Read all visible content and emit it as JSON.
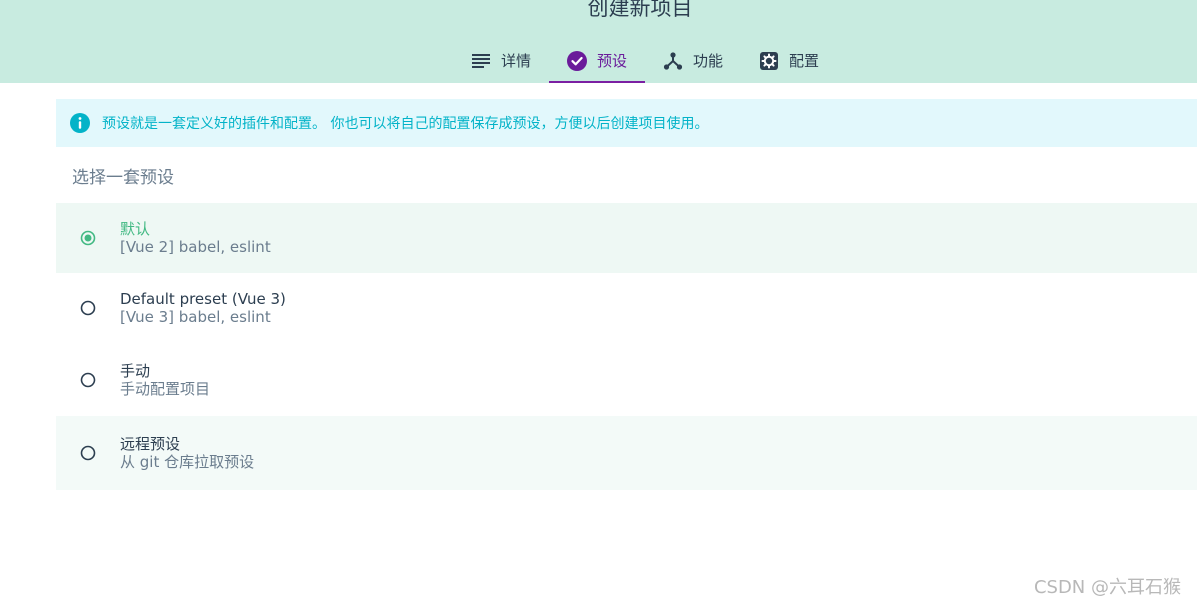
{
  "page": {
    "title": "创建新项目"
  },
  "tabs": [
    {
      "label": "详情",
      "icon": "list-icon",
      "active": false
    },
    {
      "label": "预设",
      "icon": "check-circle-icon",
      "active": true
    },
    {
      "label": "功能",
      "icon": "fork-icon",
      "active": false
    },
    {
      "label": "配置",
      "icon": "gear-icon",
      "active": false
    }
  ],
  "info": {
    "text": "预设就是一套定义好的插件和配置。 你也可以将自己的配置保存成预设，方便以后创建项目使用。"
  },
  "section": {
    "title": "选择一套预设"
  },
  "presets": [
    {
      "name": "默认",
      "desc": "[Vue 2] babel, eslint",
      "selected": true
    },
    {
      "name": "Default preset (Vue 3)",
      "desc": "[Vue 3] babel, eslint",
      "selected": false
    },
    {
      "name": "手动",
      "desc": "手动配置项目",
      "selected": false
    },
    {
      "name": "远程预设",
      "desc": "从 git 仓库拉取预设",
      "selected": false
    }
  ],
  "watermark": {
    "text": "CSDN @六耳石猴"
  },
  "colors": {
    "header_bg": "#c8ebe0",
    "accent_purple": "#7b1fa2",
    "accent_green": "#42b983",
    "info_bg": "#e2f8fc",
    "info_text": "#03b3c8"
  }
}
